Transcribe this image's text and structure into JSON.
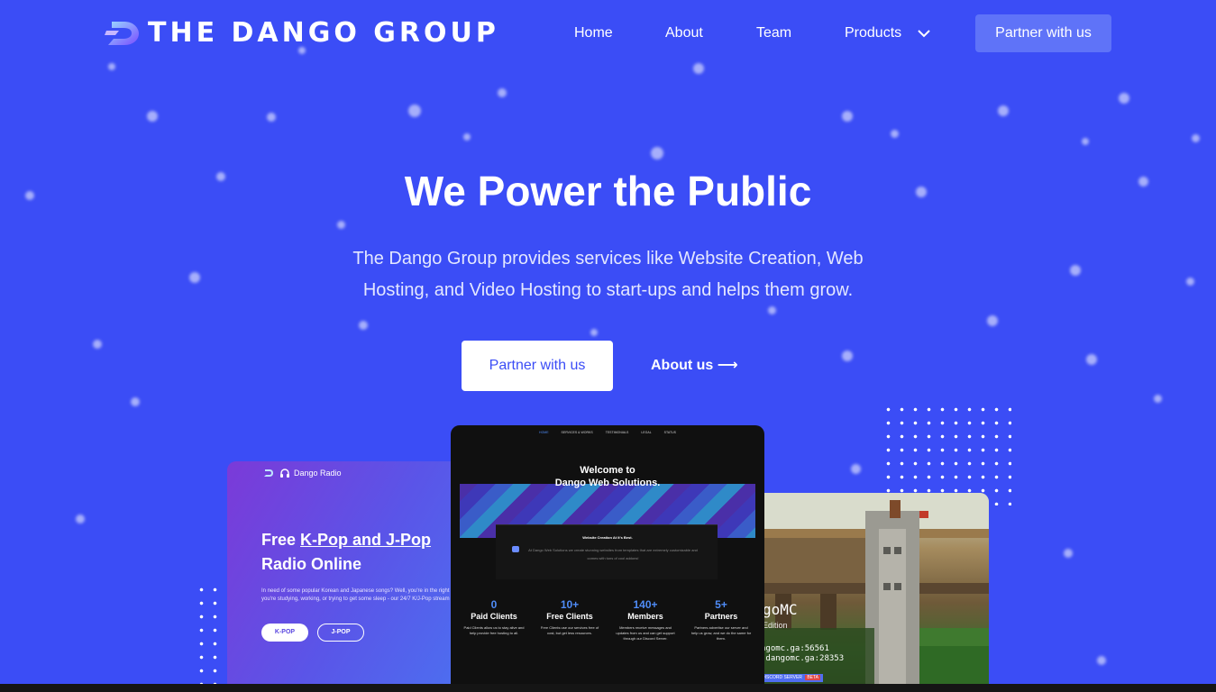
{
  "nav": {
    "brand": "THE DANGO GROUP",
    "links": [
      "Home",
      "About",
      "Team",
      "Products"
    ],
    "cta": "Partner with us"
  },
  "hero": {
    "title": "We Power the Public",
    "subtitle": "The Dango Group provides services like Website Creation, Web Hosting, and Video Hosting to start-ups and helps them grow.",
    "primary_button": "Partner with us",
    "secondary_link": "About us ⟶"
  },
  "radio_card": {
    "brand": "Dango Radio",
    "headline_prefix": "Free ",
    "headline_highlight": "K-Pop and J-Pop",
    "headline_suffix": "Radio Online",
    "body": "In need of some popular Korean and Japanese songs? Well, you're in the right place. Whether you're studying, working, or trying to get some sleep - our 24/7 K/J-Pop stream is here for you.",
    "buttons": [
      "K-POP",
      "J-POP"
    ]
  },
  "web_card": {
    "nav": [
      "HOME",
      "SERVICES & WORKS",
      "TESTIMONIALS",
      "LEGAL",
      "STATUS"
    ],
    "title_line1": "Welcome to",
    "title_line2": "Dango Web Solutions.",
    "tagline": "Website Creation At It's Best.",
    "blurb": "At Dango Web Solutions we create stunning websites from templates that are extremely customizable and comes with tons of cool addons!",
    "stats": [
      {
        "value": "0",
        "label": "Paid Clients",
        "desc": "Paid Clients allow us to stay alive and help provide free hosting to all."
      },
      {
        "value": "10+",
        "label": "Free Clients",
        "desc": "Free Clients use our services free of cost, but get less resources."
      },
      {
        "value": "140+",
        "label": "Members",
        "desc": "Members receive messages and updates from us and can get support through our Discord Server."
      },
      {
        "value": "5+",
        "label": "Partners",
        "desc": "Partners advertise our server and help us grow, and we do the same for them."
      }
    ]
  },
  "mc_card": {
    "title": "goMC",
    "edition": "Edition",
    "ip1": "ngomc.ga:56561",
    "ip2": ".dangomc.ga:28353",
    "badge_label": "DISCORD SERVER",
    "badge": "BETA"
  },
  "colors": {
    "background": "#3b4df6",
    "nav_cta": "#5f73f8",
    "accent_blue": "#4f8cf7"
  },
  "icons": [
    "dango-logo-icon",
    "chevron-down-icon",
    "headphones-icon",
    "discord-icon"
  ]
}
